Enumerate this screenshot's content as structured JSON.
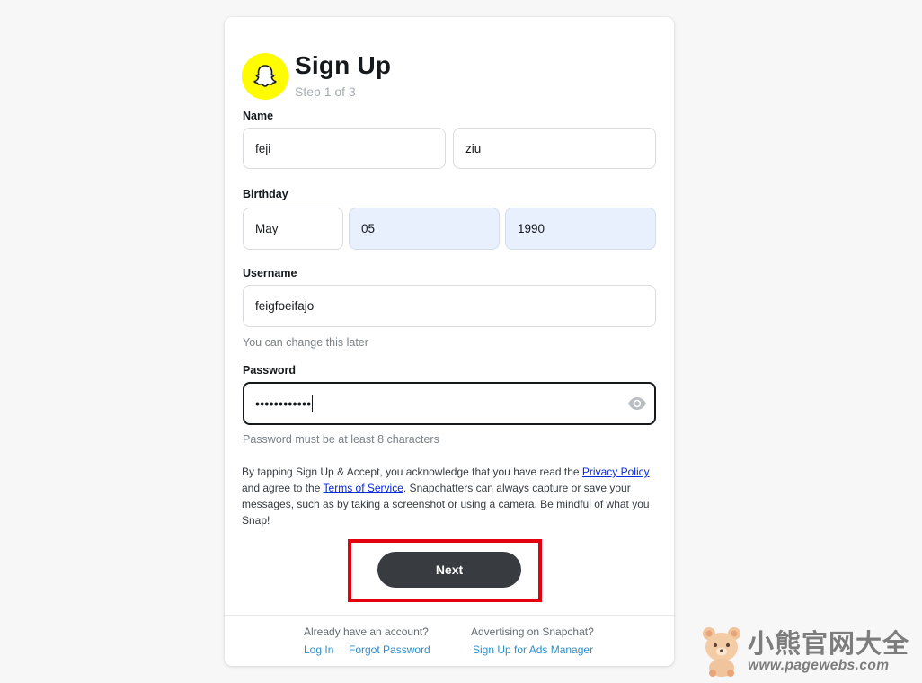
{
  "header": {
    "title": "Sign Up",
    "step": "Step 1 of 3"
  },
  "name": {
    "label": "Name",
    "first": "feji",
    "last": "ziu"
  },
  "birthday": {
    "label": "Birthday",
    "month": "May",
    "day": "05",
    "year": "1990"
  },
  "username": {
    "label": "Username",
    "value": "feigfoeifajo",
    "hint": "You can change this later"
  },
  "password": {
    "label": "Password",
    "masked_value": "••••••••••••",
    "hint": "Password must be at least 8 characters",
    "toggle_icon": "eye-icon"
  },
  "legal": {
    "prefix": "By tapping Sign Up & Accept, you acknowledge that you have read the ",
    "privacy_link": "Privacy Policy",
    "middle": " and agree to the ",
    "terms_link": "Terms of Service",
    "suffix": ". Snapchatters can always capture or save your messages, such as by taking a screenshot or using a camera. Be mindful of what you Snap!"
  },
  "actions": {
    "next_label": "Next"
  },
  "footer": {
    "account_question": "Already have an account?",
    "login_link": "Log In",
    "forgot_link": "Forgot Password",
    "ads_question": "Advertising on Snapchat?",
    "ads_link": "Sign Up for Ads Manager"
  },
  "watermark": {
    "title": "小熊官网大全",
    "url": "www.pagewebs.com"
  },
  "colors": {
    "brand_yellow": "#FFFC00",
    "button_dark": "#383c40",
    "highlight_red": "#e3000f",
    "link_blue": "#2f8ec9",
    "autofill_blue": "#e8f0fe"
  },
  "icons": {
    "logo": "snapchat-ghost-icon",
    "password_toggle": "eye-icon",
    "watermark": "bear-icon"
  }
}
